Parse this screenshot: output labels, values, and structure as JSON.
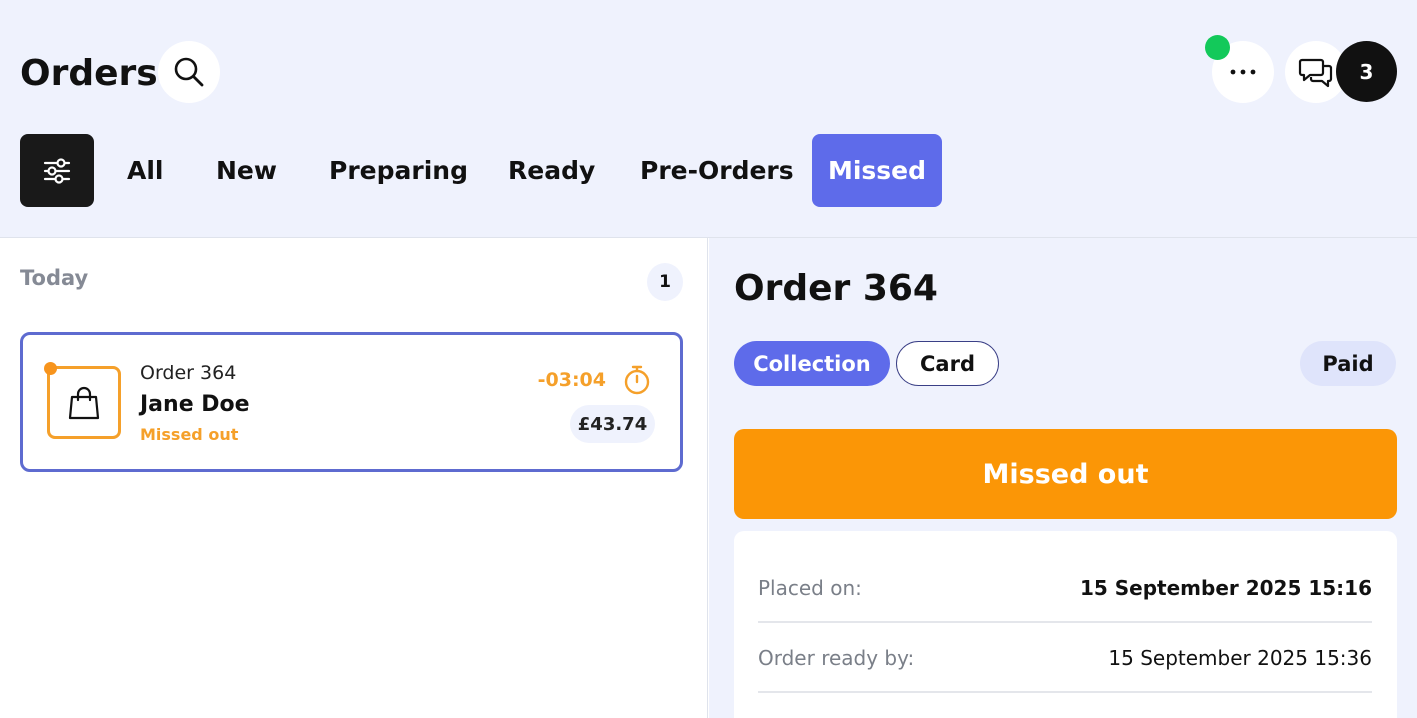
{
  "header": {
    "title": "Orders",
    "notifications_count": "3",
    "tabs": [
      {
        "label": "All",
        "active": false
      },
      {
        "label": "New",
        "active": false
      },
      {
        "label": "Preparing",
        "active": false
      },
      {
        "label": "Ready",
        "active": false
      },
      {
        "label": "Pre-Orders",
        "active": false
      },
      {
        "label": "Missed",
        "active": true
      }
    ]
  },
  "list": {
    "group_label": "Today",
    "group_count": "1",
    "orders": [
      {
        "order_number": "Order 364",
        "customer": "Jane Doe",
        "status": "Missed out",
        "timer": "-03:04",
        "total": "£43.74",
        "icon": "shopping-bag-icon"
      }
    ]
  },
  "detail": {
    "title": "Order 364",
    "type": "Collection",
    "payment_method": "Card",
    "payment_status": "Paid",
    "status_banner": "Missed out",
    "rows": [
      {
        "label": "Placed on:",
        "value": "15 September 2025 15:16"
      },
      {
        "label": "Order ready by:",
        "value": "15 September 2025 15:36"
      }
    ]
  },
  "colors": {
    "accent": "#5e6bea",
    "warning": "#fb9606",
    "online": "#13c95a",
    "header_bg": "#eff2fd"
  }
}
